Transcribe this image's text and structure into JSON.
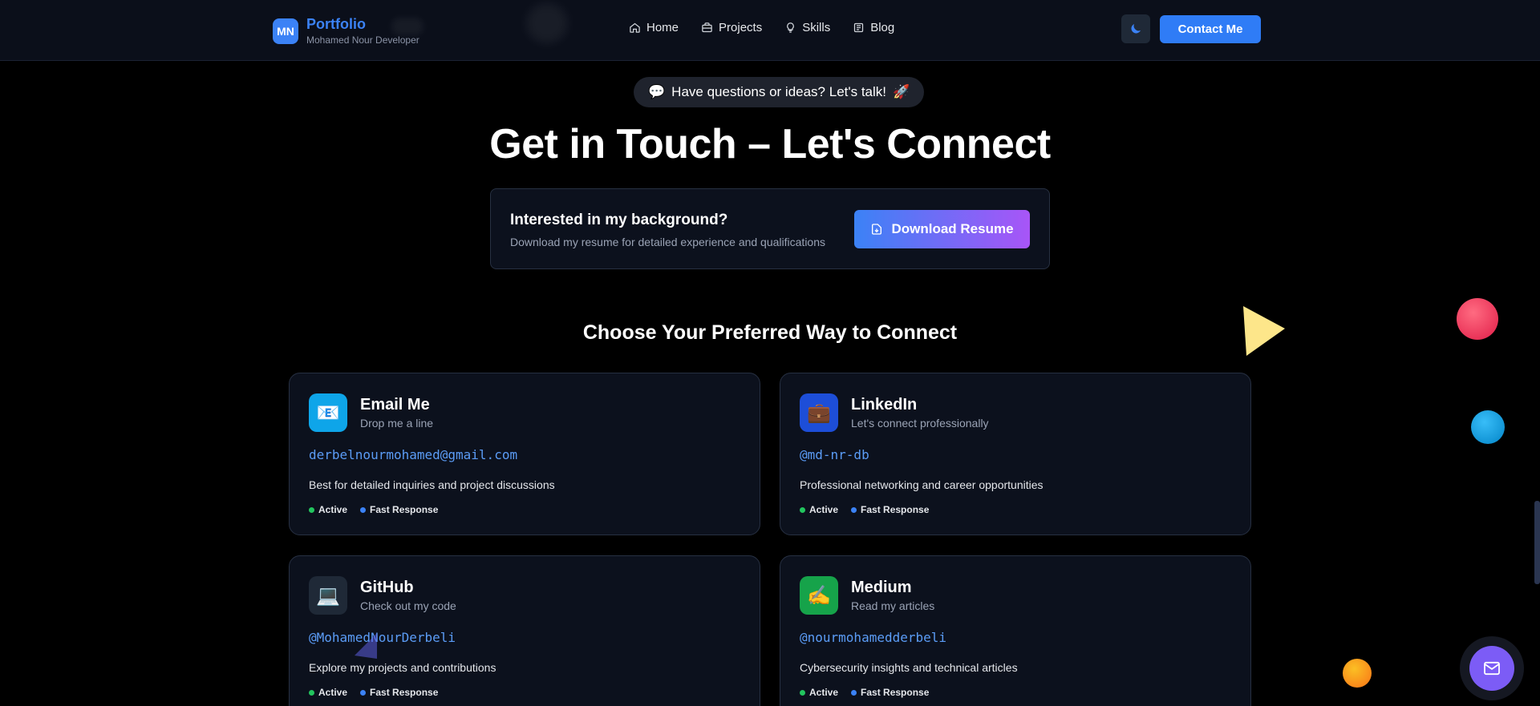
{
  "header": {
    "logo_initials": "MN",
    "brand_title": "Portfolio",
    "brand_subtitle": "Mohamed Nour Developer",
    "nav": [
      {
        "label": "Home",
        "icon": "home-icon"
      },
      {
        "label": "Projects",
        "icon": "briefcase-icon"
      },
      {
        "label": "Skills",
        "icon": "lightbulb-icon"
      },
      {
        "label": "Blog",
        "icon": "newspaper-icon"
      }
    ],
    "theme_icon": "moon-icon",
    "contact_label": "Contact Me"
  },
  "hero": {
    "pill_text": "Have questions or ideas? Let's talk!",
    "pill_emoji_left": "💬",
    "pill_emoji_right": "🚀",
    "title": "Get in Touch – Let's Connect"
  },
  "resume": {
    "title": "Interested in my background?",
    "subtitle": "Download my resume for detailed experience and qualifications",
    "button_label": "Download Resume"
  },
  "connect": {
    "section_title": "Choose Your Preferred Way to Connect",
    "cards": [
      {
        "name": "Email Me",
        "tagline": "Drop me a line",
        "handle": "derbelnourmohamed@gmail.com",
        "description": "Best for detailed inquiries and project discussions",
        "icon": "📧",
        "icon_bg": "#0ea5e9",
        "badges": [
          "Active",
          "Fast Response"
        ]
      },
      {
        "name": "LinkedIn",
        "tagline": "Let's connect professionally",
        "handle": "@md-nr-db",
        "description": "Professional networking and career opportunities",
        "icon": "💼",
        "icon_bg": "#1d4ed8",
        "badges": [
          "Active",
          "Fast Response"
        ]
      },
      {
        "name": "GitHub",
        "tagline": "Check out my code",
        "handle": "@MohamedNourDerbeli",
        "description": "Explore my projects and contributions",
        "icon": "💻",
        "icon_bg": "#1f2937",
        "badges": [
          "Active",
          "Fast Response"
        ]
      },
      {
        "name": "Medium",
        "tagline": "Read my articles",
        "handle": "@nourmohamedderbeli",
        "description": "Cybersecurity insights and technical articles",
        "icon": "✍️",
        "icon_bg": "#16a34a",
        "badges": [
          "Active",
          "Fast Response"
        ]
      }
    ]
  },
  "colors": {
    "accent": "#2f7cf6",
    "active_dot": "#22c55e",
    "fast_dot": "#3b82f6"
  },
  "fab_icon": "mail-icon"
}
